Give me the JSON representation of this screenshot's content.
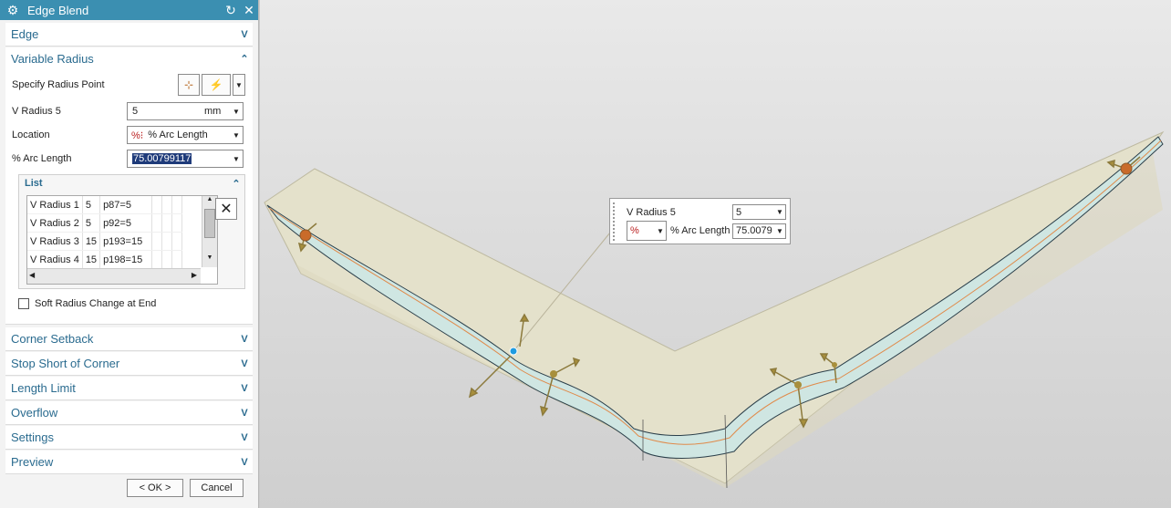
{
  "dialog": {
    "title": "Edge Blend",
    "sections": {
      "edge": "Edge",
      "variable_radius": "Variable Radius",
      "corner_setback": "Corner Setback",
      "stop_short": "Stop Short of Corner",
      "length_limit": "Length Limit",
      "overflow": "Overflow",
      "settings": "Settings",
      "preview": "Preview"
    },
    "specify_radius_point": "Specify Radius Point",
    "v_radius": {
      "label": "V Radius 5",
      "value": "5",
      "unit": "mm"
    },
    "location": {
      "label": "Location",
      "value": "% Arc Length"
    },
    "arc_length": {
      "label": "% Arc Length",
      "value": "75.00799117"
    },
    "list": {
      "title": "List",
      "rows": [
        {
          "name": "V Radius 1",
          "r": "5",
          "p": "p87=5"
        },
        {
          "name": "V Radius 2",
          "r": "5",
          "p": "p92=5"
        },
        {
          "name": "V Radius 3",
          "r": "15",
          "p": "p193=15"
        },
        {
          "name": "V Radius 4",
          "r": "15",
          "p": "p198=15"
        }
      ]
    },
    "soft_radius": "Soft Radius Change at End",
    "ok": "< OK >",
    "cancel": "Cancel"
  },
  "callout": {
    "label": "V Radius 5",
    "value": "5",
    "location_icon": "%",
    "arc_label": "% Arc Length",
    "arc_value": "75.0079"
  },
  "colors": {
    "titlebar": "#3b8fb1",
    "section_text": "#2a6b8f",
    "blend": "#cfe6e2",
    "surface": "#e2dfc9"
  }
}
